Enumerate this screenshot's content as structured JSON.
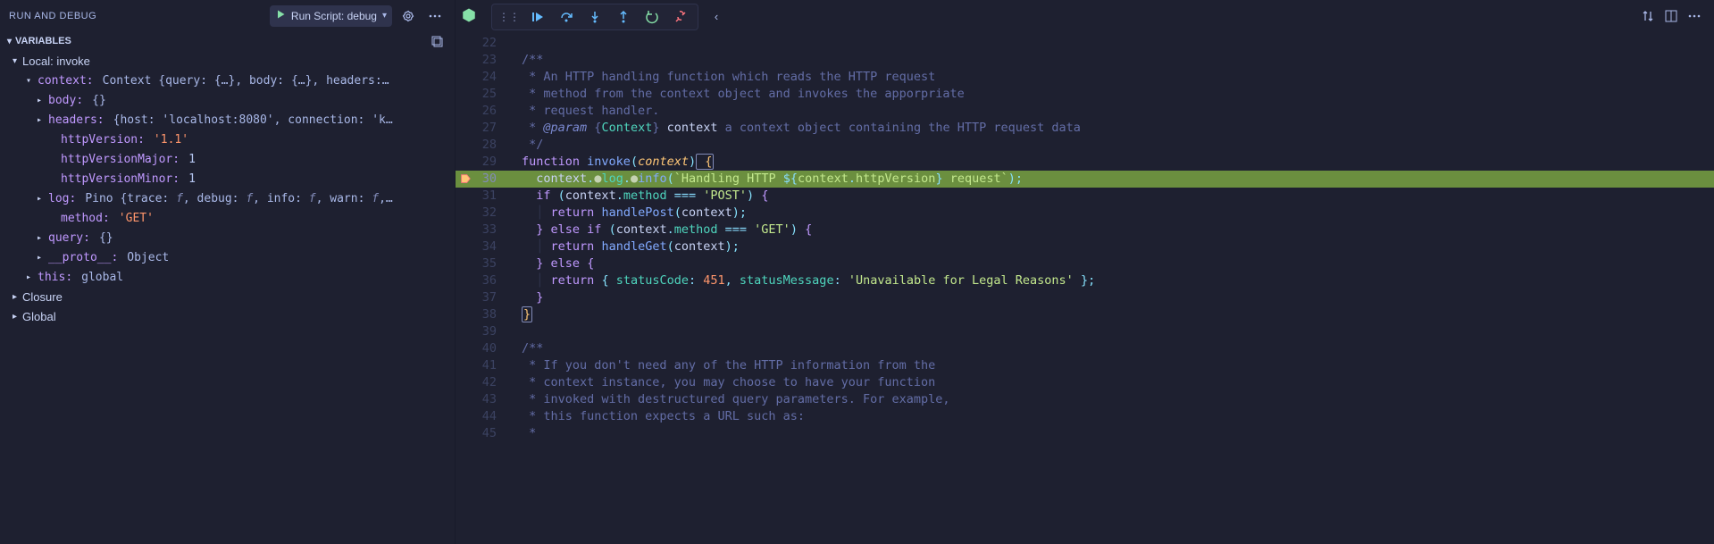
{
  "sidebar": {
    "title": "RUN AND DEBUG",
    "runConfig": {
      "label": "Run Script: debug"
    },
    "sections": {
      "variables": {
        "label": "VARIABLES",
        "scopes": [
          {
            "name": "Local: invoke",
            "expanded": true,
            "vars": {
              "context": {
                "name": "context",
                "summary": "Context {query: {…}, body: {…}, headers:…",
                "expanded": true,
                "children": {
                  "body": {
                    "name": "body",
                    "val": "{}"
                  },
                  "headers": {
                    "name": "headers",
                    "val": "{host: 'localhost:8080', connection: 'k…"
                  },
                  "httpVersion": {
                    "name": "httpVersion",
                    "val": "'1.1'"
                  },
                  "httpVersionMajor": {
                    "name": "httpVersionMajor",
                    "val": "1"
                  },
                  "httpVersionMinor": {
                    "name": "httpVersionMinor",
                    "val": "1"
                  },
                  "log": {
                    "name": "log",
                    "val_prefix": "Pino {trace: ",
                    "val_mid1": ", debug: ",
                    "val_mid2": ", info: ",
                    "val_mid3": ", warn: ",
                    "val_suffix": ",…",
                    "f": "f"
                  },
                  "method": {
                    "name": "method",
                    "val": "'GET'"
                  },
                  "query": {
                    "name": "query",
                    "val": "{}"
                  },
                  "proto": {
                    "name": "__proto__",
                    "val": "Object"
                  }
                }
              },
              "this": {
                "name": "this",
                "val": "global"
              }
            }
          },
          {
            "name": "Closure",
            "expanded": false
          },
          {
            "name": "Global",
            "expanded": false
          }
        ]
      }
    }
  },
  "editor": {
    "activeBreakpointLine": 30,
    "lines": {
      "22": "",
      "23": "/**",
      "24": " * An HTTP handling function which reads the HTTP request",
      "25": " * method from the context object and invokes the apporpriate",
      "26": " * request handler.",
      "27_pre": " * ",
      "27_tag": "@param",
      "27_brace_o": " {",
      "27_type": "Context",
      "27_brace_c": "} ",
      "27_name": "context",
      "27_desc": " a context object containing the HTTP request data",
      "28": " */",
      "29_fn": "function",
      "29_name": " invoke",
      "29_paren_o": "(",
      "29_param": "context",
      "29_paren_c": ")",
      "29_brace": " {",
      "30_indent": "  ",
      "30_a": "context",
      "30_dot": ".",
      "30_b": "log",
      "30_c": "info",
      "30_paren_o": "(",
      "30_tick": "`",
      "30_str1": "Handling HTTP ",
      "30_interp_o": "${",
      "30_iv1": "context",
      "30_iv2": "httpVersion",
      "30_interp_c": "}",
      "30_str2": " request",
      "30_paren_c": ")",
      "30_semi": ";",
      "31_if": "if",
      "31_cond_o": " (",
      "31_a": "context",
      "31_b": "method",
      "31_eq": " === ",
      "31_str": "'POST'",
      "31_cond_c": ")",
      "31_brace": " {",
      "32_ret": "return",
      "32_fn": " handlePost",
      "32_po": "(",
      "32_arg": "context",
      "32_pc": ")",
      "32_semi": ";",
      "33_brace_c": "}",
      "33_else": " else if ",
      "33_po": "(",
      "33_a": "context",
      "33_b": "method",
      "33_eq": " === ",
      "33_str": "'GET'",
      "33_pc": ")",
      "33_brace_o": " {",
      "34_ret": "return",
      "34_fn": " handleGet",
      "34_po": "(",
      "34_arg": "context",
      "34_pc": ")",
      "34_semi": ";",
      "35_brace_c": "}",
      "35_else": " else ",
      "35_brace_o": "{",
      "36_ret": "return",
      "36_brace_o": " { ",
      "36_k1": "statusCode",
      "36_c1": ": ",
      "36_v1": "451",
      "36_comma": ", ",
      "36_k2": "statusMessage",
      "36_c2": ": ",
      "36_v2": "'Unavailable for Legal Reasons'",
      "36_brace_c": " }",
      "36_semi": ";",
      "37_brace": "}",
      "38_brace": "}",
      "39": "",
      "40": "/**",
      "41": " * If you don't need any of the HTTP information from the",
      "42": " * context instance, you may choose to have your function",
      "43": " * invoked with destructured query parameters. For example,",
      "44": " * this function expects a URL such as:",
      "45": " *"
    },
    "lineNumbers": [
      "22",
      "23",
      "24",
      "25",
      "26",
      "27",
      "28",
      "29",
      "30",
      "31",
      "32",
      "33",
      "34",
      "35",
      "36",
      "37",
      "38",
      "39",
      "40",
      "41",
      "42",
      "43",
      "44",
      "45"
    ]
  }
}
